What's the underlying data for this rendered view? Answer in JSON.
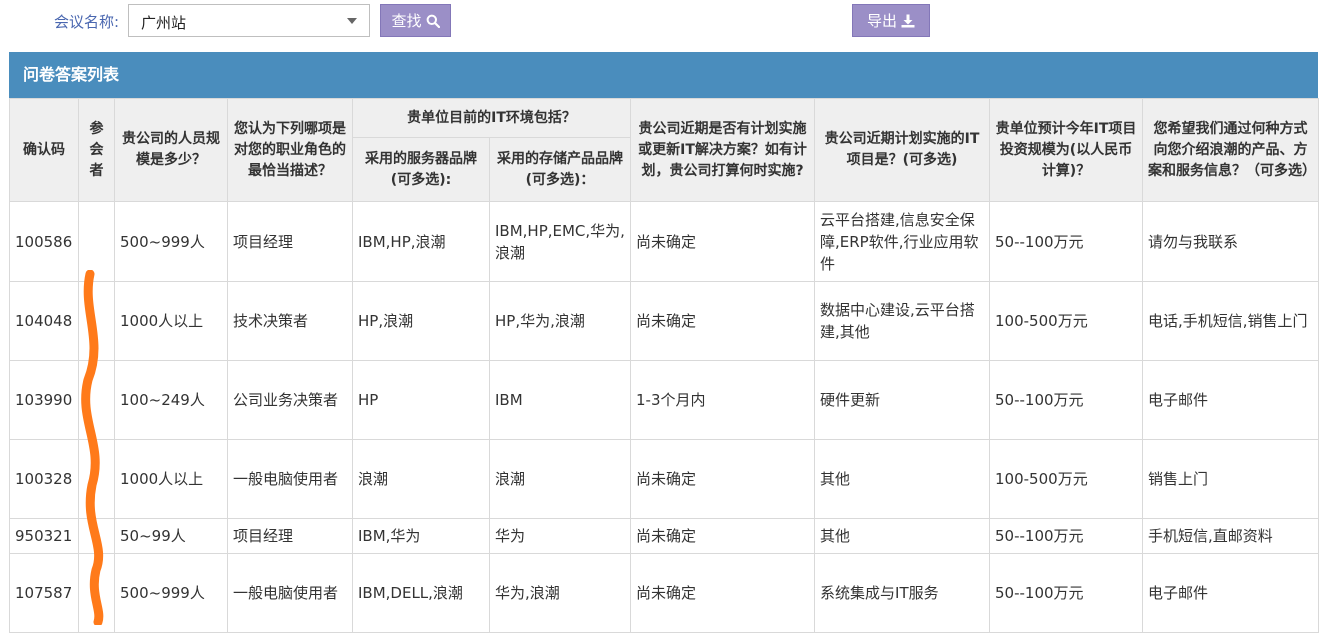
{
  "toolbar": {
    "conference_label": "会议名称:",
    "conference_value": "广州站",
    "search_label": "查找",
    "export_label": "导出"
  },
  "panel": {
    "title": "问卷答案列表"
  },
  "table": {
    "headers": {
      "confirm_code": "确认码",
      "attendee": "参会者",
      "company_size": "贵公司的人员规模是多少？",
      "role": "您认为下列哪项是对您的职业角色的最恰当描述？",
      "it_env_group": "贵单位目前的IT环境包括？",
      "server_brand": "采用的服务器品牌(可多选):",
      "storage_brand": "采用的存储产品品牌(可多选)：",
      "it_plan": "贵公司近期是否有计划实施或更新IT解决方案？如有计划，贵公司打算何时实施?",
      "it_projects": "贵公司近期计划实施的IT项目是？(可多选)",
      "budget": "贵单位预计今年IT项目投资规模为(以人民币计算)？",
      "contact_method": "您希望我们通过何种方式向您介绍浪潮的产品、方案和服务信息？（可多选）"
    },
    "rows": [
      {
        "code": "100586",
        "attendee": "",
        "size": "500~999人",
        "role": "项目经理",
        "server": "IBM,HP,浪潮",
        "storage": "IBM,HP,EMC,华为,浪潮",
        "plan": "尚未确定",
        "projects": "云平台搭建,信息安全保障,ERP软件,行业应用软件",
        "budget": "50--100万元",
        "contact": "请勿与我联系"
      },
      {
        "code": "104048",
        "attendee": "",
        "size": "1000人以上",
        "role": "技术决策者",
        "server": "HP,浪潮",
        "storage": "HP,华为,浪潮",
        "plan": "尚未确定",
        "projects": "数据中心建设,云平台搭建,其他",
        "budget": "100-500万元",
        "contact": "电话,手机短信,销售上门"
      },
      {
        "code": "103990",
        "attendee": "",
        "size": "100~249人",
        "role": "公司业务决策者",
        "server": "HP",
        "storage": "IBM",
        "plan": "1-3个月内",
        "projects": "硬件更新",
        "budget": "50--100万元",
        "contact": "电子邮件"
      },
      {
        "code": "100328",
        "attendee": "",
        "size": "1000人以上",
        "role": "一般电脑使用者",
        "server": "浪潮",
        "storage": "浪潮",
        "plan": "尚未确定",
        "projects": "其他",
        "budget": "100-500万元",
        "contact": "销售上门"
      },
      {
        "code": "950321",
        "attendee": "",
        "size": "50~99人",
        "role": "项目经理",
        "server": "IBM,华为",
        "storage": "华为",
        "plan": "尚未确定",
        "projects": "其他",
        "budget": "50--100万元",
        "contact": "手机短信,直邮资料"
      },
      {
        "code": "107587",
        "attendee": "",
        "size": "500~999人",
        "role": "一般电脑使用者",
        "server": "IBM,DELL,浪潮",
        "storage": "华为,浪潮",
        "plan": "尚未确定",
        "projects": "系统集成与IT服务",
        "budget": "50--100万元",
        "contact": "电子邮件"
      }
    ]
  },
  "colors": {
    "header_bar": "#4a8dbd",
    "button": "#9b8fc7",
    "redaction_mark": "#ff7a1a"
  }
}
